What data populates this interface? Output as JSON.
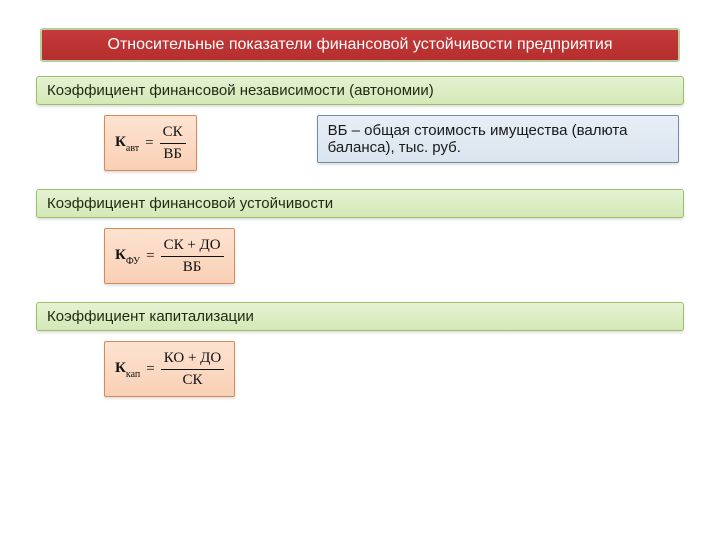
{
  "title": "Относительные показатели финансовой устойчивости предприятия",
  "sections": [
    {
      "heading": "Коэффициент финансовой независимости (автономии)",
      "formula": {
        "symbol": "К",
        "subscript": "авт",
        "numerator": "СК",
        "denominator": "ВБ"
      },
      "note": "ВБ – общая стоимость имущества (валюта баланса), тыс. руб."
    },
    {
      "heading": "Коэффициент финансовой устойчивости",
      "formula": {
        "symbol": "К",
        "subscript": "ФУ",
        "numerator": "СК + ДО",
        "denominator": "ВБ"
      }
    },
    {
      "heading": "Коэффициент капитализации",
      "formula": {
        "symbol": "К",
        "subscript": "кап",
        "numerator": "КО + ДО",
        "denominator": "СК"
      }
    }
  ]
}
